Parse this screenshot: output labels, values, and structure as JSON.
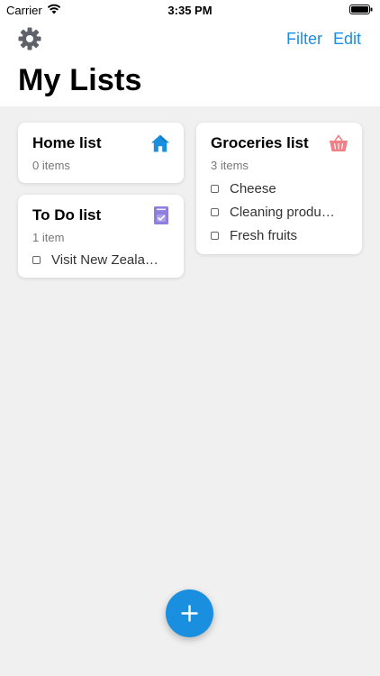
{
  "status_bar": {
    "carrier": "Carrier",
    "time": "3:35 PM",
    "icons": [
      "wifi-icon",
      "battery-icon"
    ]
  },
  "header": {
    "settings_icon": "gear-icon",
    "filter_label": "Filter",
    "edit_label": "Edit",
    "title": "My Lists"
  },
  "lists": [
    {
      "title": "Home list",
      "count": "0 items",
      "icon": "house-icon",
      "icon_color": "#1a8fe0",
      "items": []
    },
    {
      "title": "To Do list",
      "count": "1 item",
      "icon": "checklist-icon",
      "icon_color": "#8e7ee0",
      "items": [
        "Visit New Zeala…"
      ]
    },
    {
      "title": "Groceries list",
      "count": "3 items",
      "icon": "basket-icon",
      "icon_color": "#f07f86",
      "items": [
        "Cheese",
        "Cleaning produ…",
        "Fresh fruits"
      ]
    }
  ],
  "fab": {
    "icon": "plus-icon",
    "color": "#1a8fe0"
  },
  "colors": {
    "accent": "#1a8fe0",
    "background": "#f0f0f0",
    "card": "#ffffff"
  }
}
